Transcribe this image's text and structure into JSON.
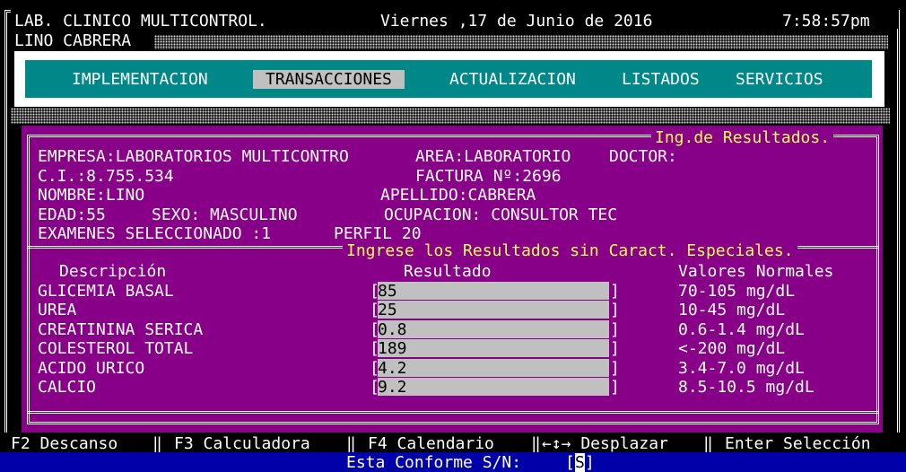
{
  "header": {
    "lab_name": "LAB. CLINICO MULTICONTROL.",
    "date": "Viernes ,17 de Junio de 2016",
    "time": "7:58:57pm",
    "user": "LINO CABRERA"
  },
  "menu": {
    "items": [
      "IMPLEMENTACION",
      "TRANSACCIONES",
      "ACTUALIZACION",
      "LISTADOS",
      "SERVICIOS"
    ],
    "selected": "TRANSACCIONES"
  },
  "panel": {
    "title": "Ing.de Resultados.",
    "empresa": "EMPRESA:LABORATORIOS MULTICONTRO",
    "area": "AREA:LABORATORIO",
    "doctor": "DOCTOR:",
    "ci": "C.I.:8.755.534",
    "factura": "FACTURA Nº:2696",
    "nombre": "NOMBRE:LINO",
    "apellido": "APELLIDO:CABRERA",
    "edad": "EDAD:55",
    "sexo": "SEXO: MASCULINO",
    "ocupacion": "OCUPACION: CONSULTOR TEC",
    "examenes": "EXAMENES SELECCIONADO :1",
    "perfil": "PERFIL 20",
    "instruction": "Ingrese los Resultados sin Caract. Especiales."
  },
  "table": {
    "headers": {
      "descripcion": "Descripción",
      "resultado": "Resultado",
      "valores": "Valores Normales"
    },
    "rows": [
      {
        "desc": "GLICEMIA BASAL",
        "result": "85",
        "normal": "70-105 mg/dL"
      },
      {
        "desc": "UREA",
        "result": "25",
        "normal": "10-45 mg/dL"
      },
      {
        "desc": "CREATININA SERICA",
        "result": "0.8",
        "normal": "0.6-1.4 mg/dL"
      },
      {
        "desc": "COLESTEROL TOTAL",
        "result": "189",
        "normal": "<-200 mg/dL"
      },
      {
        "desc": "ACIDO URICO",
        "result": "4.2",
        "normal": "3.4-7.0 mg/dL"
      },
      {
        "desc": "CALCIO",
        "result": "9.2",
        "normal": "8.5-10.5 mg/dL"
      }
    ]
  },
  "footer": {
    "f2": "F2 Descanso",
    "f3": "F3 Calculadora",
    "f4": "F4 Calendario",
    "move": "←↕→ Desplazar",
    "enter": "Enter Selección",
    "confirm_prompt": "Esta Conforme S/N:",
    "confirm_value": "S"
  },
  "colors": {
    "background": "#000000",
    "teal": "#008787",
    "panel": "#870087",
    "highlight": "#ffff54",
    "status_bar": "#0000a8"
  }
}
